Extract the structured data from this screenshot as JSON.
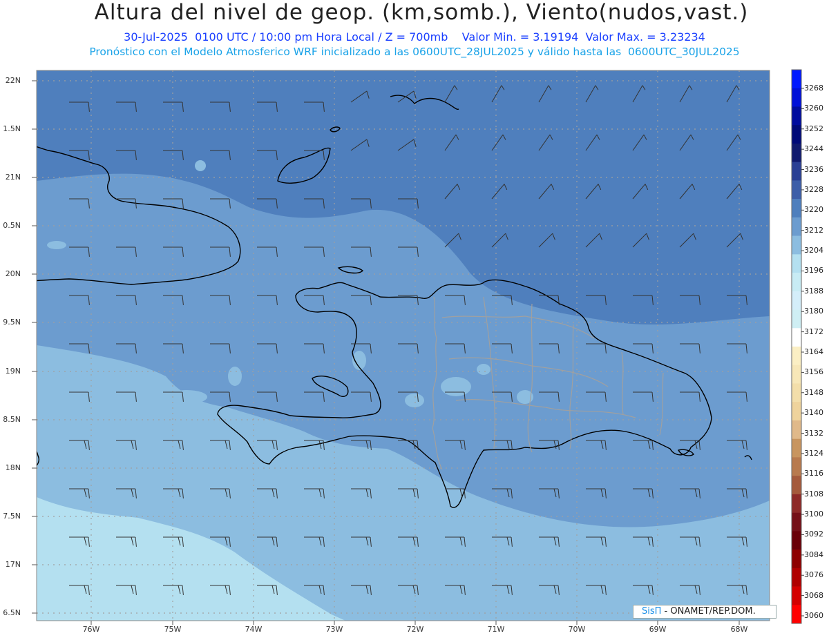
{
  "header": {
    "title": "Altura del nivel de geop. (km,somb.), Viento(nudos,vast.)",
    "subtitle": "30-Jul-2025  0100 UTC / 10:00 pm Hora Local / Z = 700mb    Valor Min. = 3.19194  Valor Max. = 3.23234",
    "model_info": "Pronóstico con el Modelo Atmosferico WRF inicializado a las 0600UTC_28JUL2025 y válido hasta las  0600UTC_30JUL2025"
  },
  "map": {
    "lat_labels": [
      "22N",
      "1.5N",
      "21N",
      "0.5N",
      "20N",
      "9.5N",
      "19N",
      "8.5N",
      "18N",
      "7.5N",
      "17N",
      "6.5N"
    ],
    "lon_labels": [
      "76W",
      "75W",
      "74W",
      "73W",
      "72W",
      "71W",
      "70W",
      "69W",
      "68W"
    ],
    "fill_colors": {
      "band_3228": "#4f7fbd",
      "band_3220": "#6c9ccf",
      "band_3212": "#8cbde0",
      "band_3204": "#b4e0f0"
    },
    "coast_color": "#000000",
    "province_border_color": "#a0a0a0",
    "grid_color": "#a0a0a0",
    "barb_color": "#333333"
  },
  "colorbar": {
    "labels": [
      "3268",
      "3260",
      "3252",
      "3244",
      "3236",
      "3228",
      "3220",
      "3212",
      "3204",
      "3196",
      "3188",
      "3180",
      "3172",
      "3164",
      "3156",
      "3148",
      "3140",
      "3132",
      "3124",
      "3116",
      "3108",
      "3100",
      "3092",
      "3084",
      "3076",
      "3068",
      "3060"
    ],
    "colors": [
      "#0018ff",
      "#0010d8",
      "#000c9e",
      "#000a78",
      "#101a6e",
      "#2a3f94",
      "#3d5ea8",
      "#4f7fbd",
      "#6c9ccf",
      "#8cbde0",
      "#b4e0f0",
      "#c8ecf4",
      "#d4eefa",
      "#cfeff4",
      "#ffffff",
      "#fbefc4",
      "#f7e7b8",
      "#f3deaa",
      "#efd39c",
      "#e0b98a",
      "#c8955f",
      "#b87a4e",
      "#a55a3c",
      "#8e2a28",
      "#751018",
      "#6a0008",
      "#8e0000",
      "#b00000",
      "#d40000",
      "#ff0000"
    ]
  },
  "credit": {
    "brand": "SisΠ",
    "org": " - ONAMET/REP.DOM."
  }
}
